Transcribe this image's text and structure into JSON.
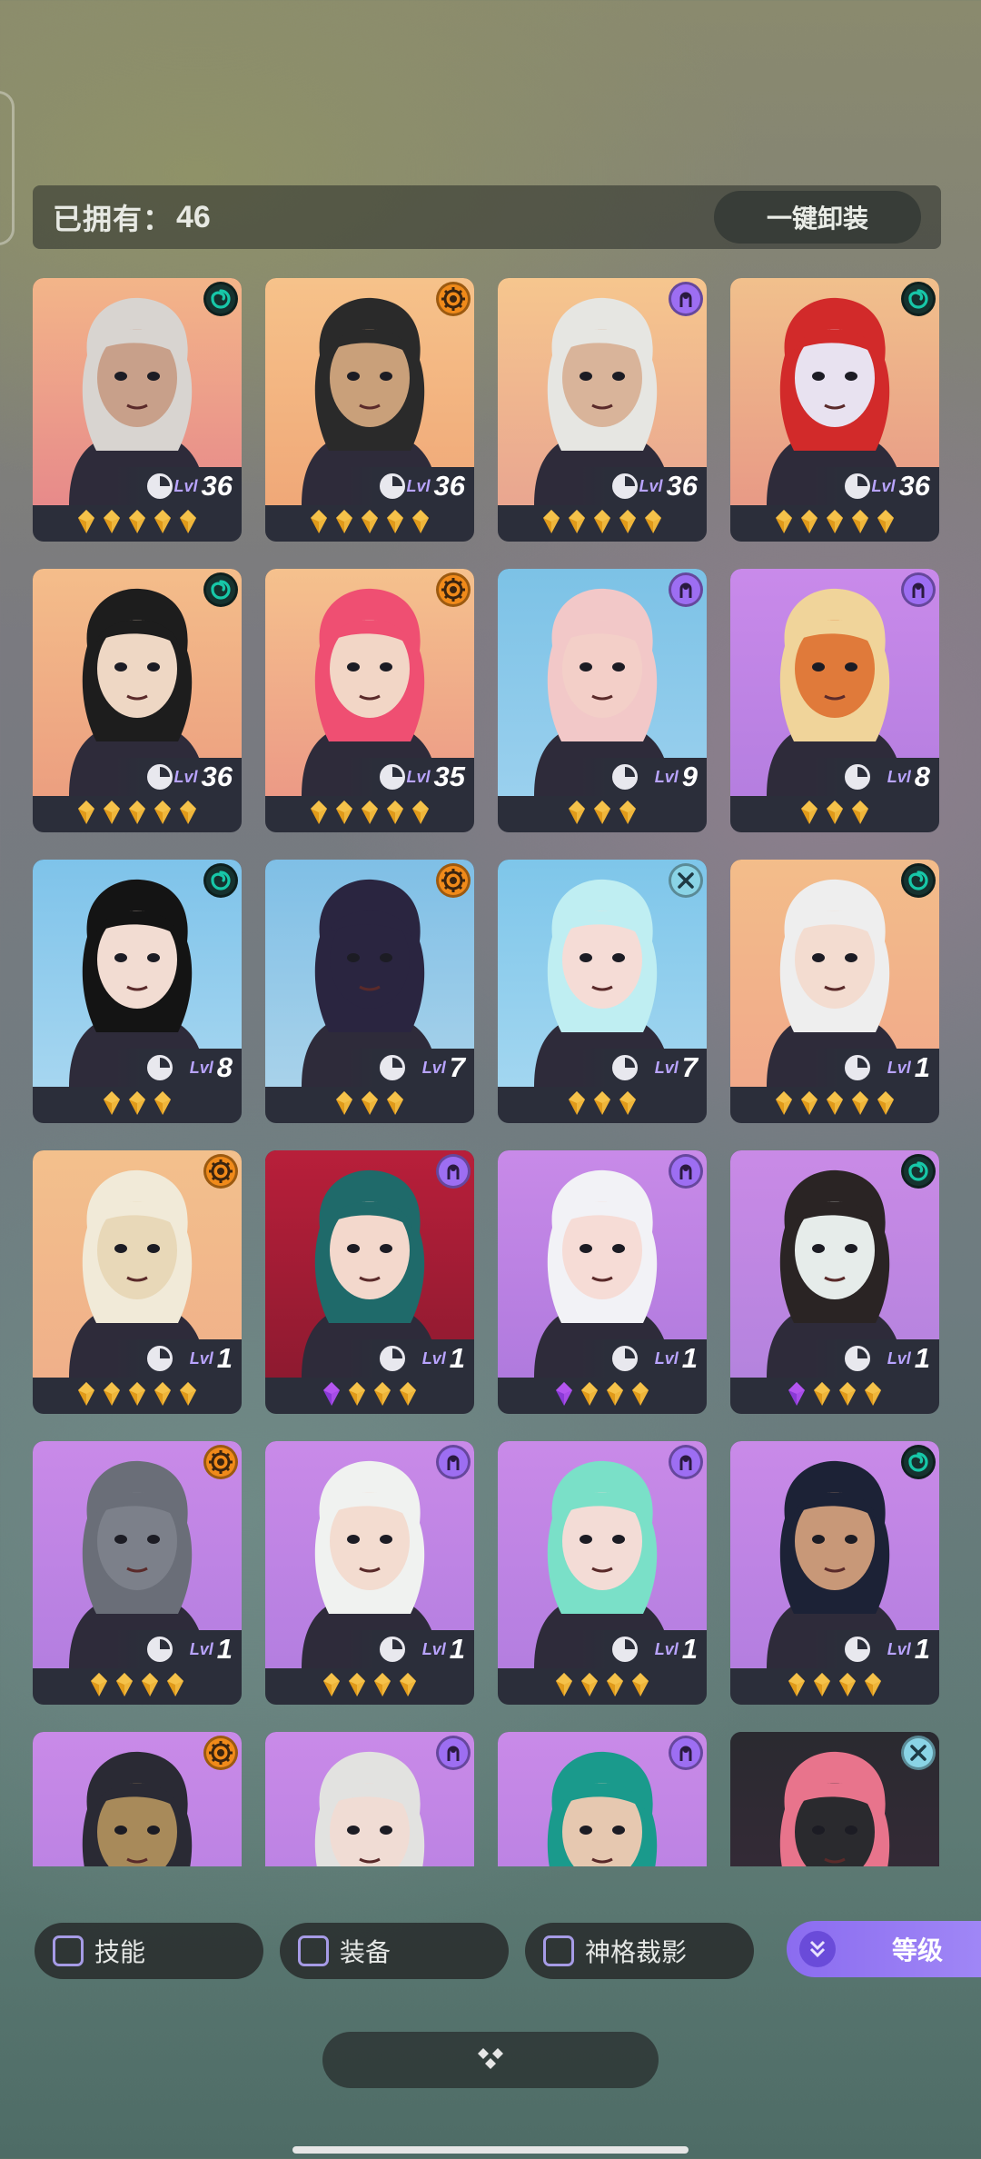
{
  "header": {
    "owned_label": "已拥有：",
    "owned_count": "46",
    "unequip_all_label": "一键卸装"
  },
  "elements": {
    "swirl": {
      "icon": "swirl-icon",
      "color": "#17c7a8"
    },
    "gear": {
      "icon": "gear-icon",
      "color": "#f08a1a"
    },
    "mind": {
      "icon": "mind-icon",
      "color": "#9d6ef2"
    },
    "cross": {
      "icon": "cross-icon",
      "color": "#8ad4e6"
    }
  },
  "cards": [
    {
      "element": "swirl",
      "bg": [
        "#f3b589",
        "#e78a8a"
      ],
      "hair": "#d8d4d0",
      "skin": "#c8a08a",
      "level": "36",
      "lvl_prefix": "Lvl",
      "stars": 5,
      "purple_gems": 0
    },
    {
      "element": "gear",
      "bg": [
        "#f6c28a",
        "#f0a878"
      ],
      "hair": "#2a2a2a",
      "skin": "#c9a07a",
      "level": "36",
      "lvl_prefix": "Lvl",
      "stars": 5,
      "purple_gems": 0
    },
    {
      "element": "mind",
      "bg": [
        "#f6c68e",
        "#e9a690"
      ],
      "hair": "#e6e6e2",
      "skin": "#d9b49a",
      "level": "36",
      "lvl_prefix": "Lvl",
      "stars": 5,
      "purple_gems": 0
    },
    {
      "element": "swirl",
      "bg": [
        "#f1c08c",
        "#e89a86"
      ],
      "hair": "#d22a2a",
      "skin": "#e8e2f0",
      "level": "36",
      "lvl_prefix": "Lvl",
      "stars": 5,
      "purple_gems": 0
    },
    {
      "element": "swirl",
      "bg": [
        "#f4bd8a",
        "#ec9f80"
      ],
      "hair": "#1d1d1d",
      "skin": "#eed7c4",
      "level": "36",
      "lvl_prefix": "Lvl",
      "stars": 5,
      "purple_gems": 0
    },
    {
      "element": "gear",
      "bg": [
        "#f5c18d",
        "#ec9a86"
      ],
      "hair": "#ef4f72",
      "skin": "#f2d6c6",
      "level": "35",
      "lvl_prefix": "Lvl",
      "stars": 5,
      "purple_gems": 0
    },
    {
      "element": "mind",
      "bg": [
        "#7cc2e6",
        "#9ad0ee"
      ],
      "hair": "#f2c8c8",
      "skin": "#f3cfc8",
      "level": "9",
      "lvl_prefix": "Lvl",
      "stars": 3,
      "purple_gems": 0
    },
    {
      "element": "mind",
      "bg": [
        "#c98aea",
        "#b57ee0"
      ],
      "hair": "#f0d49a",
      "skin": "#e07a3a",
      "level": "8",
      "lvl_prefix": "Lvl",
      "stars": 3,
      "purple_gems": 0
    },
    {
      "element": "swirl",
      "bg": [
        "#7ec3ea",
        "#a6d6f0"
      ],
      "hair": "#141414",
      "skin": "#f2dcd2",
      "level": "8",
      "lvl_prefix": "Lvl",
      "stars": 3,
      "purple_gems": 0
    },
    {
      "element": "gear",
      "bg": [
        "#7fbfe6",
        "#a8d2ea"
      ],
      "hair": "#2a2540",
      "skin": "#2a2540",
      "level": "7",
      "lvl_prefix": "Lvl",
      "stars": 3,
      "purple_gems": 0
    },
    {
      "element": "cross",
      "bg": [
        "#7ec6ea",
        "#a2d6f0"
      ],
      "hair": "#bfeef2",
      "skin": "#f5dcd6",
      "level": "7",
      "lvl_prefix": "Lvl",
      "stars": 3,
      "purple_gems": 0
    },
    {
      "element": "swirl",
      "bg": [
        "#f3bd8a",
        "#f1a98a"
      ],
      "hair": "#eeeeee",
      "skin": "#f3dcd0",
      "level": "1",
      "lvl_prefix": "Lvl",
      "stars": 5,
      "purple_gems": 0
    },
    {
      "element": "gear",
      "bg": [
        "#f3c08c",
        "#f0b08a"
      ],
      "hair": "#f1ead8",
      "skin": "#e8d8b8",
      "level": "1",
      "lvl_prefix": "Lvl",
      "stars": 5,
      "purple_gems": 0
    },
    {
      "element": "mind",
      "bg": [
        "#b81f3a",
        "#8e1a30"
      ],
      "hair": "#1f6a6a",
      "skin": "#f3d8cc",
      "level": "1",
      "lvl_prefix": "Lvl",
      "stars": 4,
      "purple_gems": 1
    },
    {
      "element": "mind",
      "bg": [
        "#c88ae8",
        "#b07ade"
      ],
      "hair": "#f2f2f6",
      "skin": "#f6dcd6",
      "level": "1",
      "lvl_prefix": "Lvl",
      "stars": 4,
      "purple_gems": 1
    },
    {
      "element": "swirl",
      "bg": [
        "#c98ae6",
        "#b483de"
      ],
      "hair": "#2a2424",
      "skin": "#e6ecea",
      "level": "1",
      "lvl_prefix": "Lvl",
      "stars": 4,
      "purple_gems": 1
    },
    {
      "element": "gear",
      "bg": [
        "#c98ae8",
        "#b47ee0"
      ],
      "hair": "#6a6e78",
      "skin": "#7c808a",
      "level": "1",
      "lvl_prefix": "Lvl",
      "stars": 4,
      "purple_gems": 0
    },
    {
      "element": "mind",
      "bg": [
        "#c98ae8",
        "#b47ee0"
      ],
      "hair": "#f0f2f0",
      "skin": "#f3dcd0",
      "level": "1",
      "lvl_prefix": "Lvl",
      "stars": 4,
      "purple_gems": 0
    },
    {
      "element": "mind",
      "bg": [
        "#c98ae8",
        "#b47ee0"
      ],
      "hair": "#7ae0c8",
      "skin": "#f3dcd6",
      "level": "1",
      "lvl_prefix": "Lvl",
      "stars": 4,
      "purple_gems": 0
    },
    {
      "element": "swirl",
      "bg": [
        "#c98ae8",
        "#b47ee0"
      ],
      "hair": "#1c2236",
      "skin": "#c89878",
      "level": "1",
      "lvl_prefix": "Lvl",
      "stars": 4,
      "purple_gems": 0
    },
    {
      "element": "gear",
      "bg": [
        "#c98ae8",
        "#b47ee0"
      ],
      "hair": "#2a2a34",
      "skin": "#a88a5a",
      "level": "",
      "lvl_prefix": "",
      "stars": 0,
      "purple_gems": 0
    },
    {
      "element": "mind",
      "bg": [
        "#c98ae8",
        "#b47ee0"
      ],
      "hair": "#e2e2e0",
      "skin": "#f0dcd4",
      "level": "",
      "lvl_prefix": "",
      "stars": 0,
      "purple_gems": 0
    },
    {
      "element": "mind",
      "bg": [
        "#c98ae8",
        "#b47ee0"
      ],
      "hair": "#1a9a8c",
      "skin": "#e6c8b0",
      "level": "",
      "lvl_prefix": "",
      "stars": 0,
      "purple_gems": 0
    },
    {
      "element": "cross",
      "bg": [
        "#2a2a30",
        "#3a2a3a"
      ],
      "hair": "#e8748c",
      "skin": "#2a2a2e",
      "level": "",
      "lvl_prefix": "",
      "stars": 0,
      "purple_gems": 0
    }
  ],
  "filters": [
    {
      "label": "技能"
    },
    {
      "label": "装备"
    },
    {
      "label": "神格裁影"
    }
  ],
  "sort_button": {
    "label": "等级",
    "icon": "double-chevron-down-icon"
  },
  "more_button": {
    "icon": "diamond-cluster-icon"
  }
}
